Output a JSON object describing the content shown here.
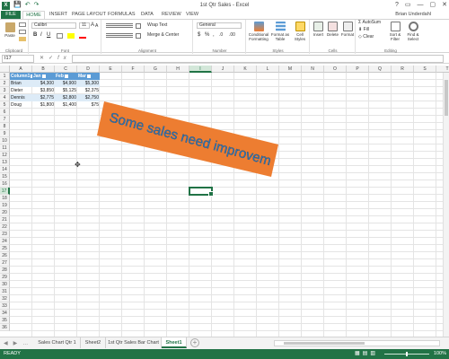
{
  "window": {
    "title": "1st Qtr Sales - Excel",
    "user": "Brian Underdahl",
    "controls": [
      "?",
      "▭",
      "—",
      "▢",
      "✕"
    ]
  },
  "qat": {
    "save": "💾",
    "undo": "↶",
    "redo": "↷"
  },
  "tabs": [
    "FILE",
    "HOME",
    "INSERT",
    "PAGE LAYOUT",
    "FORMULAS",
    "DATA",
    "REVIEW",
    "VIEW"
  ],
  "ribbon": {
    "clipboard": {
      "label": "Clipboard",
      "paste": "Paste"
    },
    "font": {
      "label": "Font",
      "name": "Calibri",
      "size": "11",
      "bold": "B",
      "italic": "I",
      "underline": "U",
      "grow": "A",
      "shrink": "A"
    },
    "alignment": {
      "label": "Alignment",
      "wrap": "Wrap Text",
      "merge": "Merge & Center"
    },
    "number": {
      "label": "Number",
      "format": "General",
      "currency": "$",
      "percent": "%",
      "comma": ",",
      "inc": ".0",
      "dec": ".00"
    },
    "styles": {
      "label": "Styles",
      "conditional": "Conditional Formatting",
      "table": "Format as Table",
      "cell": "Cell Styles"
    },
    "cells": {
      "label": "Cells",
      "insert": "Insert",
      "delete": "Delete",
      "format": "Format"
    },
    "editing": {
      "label": "Editing",
      "autosum": "AutoSum",
      "fill": "Fill",
      "clear": "Clear",
      "sort": "Sort & Filter",
      "find": "Find & Select"
    }
  },
  "formula_bar": {
    "name_box": "I17",
    "fx": "fx",
    "cancel": "✕",
    "enter": "✓",
    "value": ""
  },
  "columns": [
    "A",
    "B",
    "C",
    "D",
    "E",
    "F",
    "G",
    "H",
    "I",
    "J",
    "K",
    "L",
    "M",
    "N",
    "O",
    "P",
    "Q",
    "R",
    "S",
    "T"
  ],
  "selected": {
    "column": "I",
    "row": "17"
  },
  "rows": [
    "1",
    "2",
    "3",
    "4",
    "5",
    "6",
    "7",
    "8",
    "9",
    "10",
    "11",
    "12",
    "13",
    "14",
    "15",
    "16",
    "17",
    "18",
    "19",
    "20",
    "21",
    "22",
    "23",
    "24",
    "25",
    "26",
    "27",
    "28",
    "29",
    "30",
    "31",
    "32",
    "33",
    "34",
    "35",
    "36"
  ],
  "table": {
    "headers": [
      "Column1",
      "Jan",
      "Feb",
      "Mar"
    ],
    "rows": [
      [
        "Brian",
        "$4,300",
        "$4,900",
        "$5,300"
      ],
      [
        "Dieter",
        "$3,850",
        "$5,125",
        "$2,375"
      ],
      [
        "Dennis",
        "$2,775",
        "$2,800",
        "$2,750"
      ],
      [
        "Doug",
        "$1,800",
        "$1,400",
        "$75"
      ]
    ]
  },
  "wordart": {
    "text": "Some sales need improvement!",
    "fill": "#ed7d31",
    "text_color": "#2e75b6"
  },
  "sheets": [
    {
      "name": "Sales Chart Qtr 1",
      "active": false
    },
    {
      "name": "Sheet2",
      "active": false
    },
    {
      "name": "1st Qtr Sales Bar Chart",
      "active": false
    },
    {
      "name": "Sheet1",
      "active": true
    }
  ],
  "status": {
    "mode": "READY",
    "zoom": "100%"
  },
  "colors": {
    "excel_green": "#217346",
    "table_header": "#5b9bd5",
    "table_band": "#ddebf7"
  }
}
